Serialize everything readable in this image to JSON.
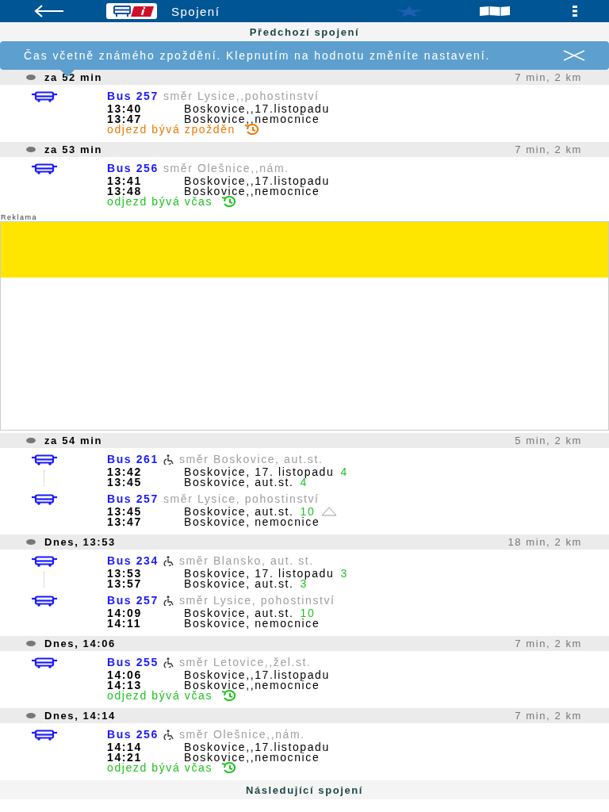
{
  "app_bar": {
    "title": "Spojení",
    "favorite": false
  },
  "previous_button": "Předchozí spojení",
  "tooltip": {
    "text": "Čas včetně známého zpoždění. Klepnutím na hodnotu změníte nastavení."
  },
  "connections": [
    {
      "header": "za 52 min",
      "summary": "7 min, 2 km",
      "legs": [
        {
          "line": "Bus 257",
          "accessible": false,
          "direction": "směr Lysice,,pohostinství",
          "stops": [
            {
              "time": "13:40",
              "name": "Boskovice,,17.listopadu",
              "alert": false
            },
            {
              "time": "13:47",
              "name": "Boskovice,,nemocnice",
              "alert": false
            }
          ]
        }
      ],
      "status": {
        "kind": "late",
        "text": "odjezd bývá zpožděn"
      }
    },
    {
      "header": "za 53 min",
      "summary": "7 min, 2 km",
      "legs": [
        {
          "line": "Bus 256",
          "accessible": false,
          "direction": "směr Olešnice,,nám.",
          "stops": [
            {
              "time": "13:41",
              "name": "Boskovice,,17.listopadu",
              "alert": false
            },
            {
              "time": "13:48",
              "name": "Boskovice,,nemocnice",
              "alert": false
            }
          ]
        }
      ],
      "status": {
        "kind": "ontime",
        "text": "odjezd bývá včas"
      }
    },
    {
      "kind": "ad",
      "label": "Reklama"
    },
    {
      "header": "za 54 min",
      "summary": "5 min, 2 km",
      "legs": [
        {
          "line": "Bus 261",
          "accessible": true,
          "direction": "směr Boskovice, aut.st.",
          "stops": [
            {
              "time": "13:42",
              "name": "Boskovice, 17. listopadu",
              "platform": "4",
              "alert": false
            },
            {
              "time": "13:45",
              "name": "Boskovice, aut.st.",
              "platform": "4",
              "alert": false
            }
          ]
        },
        {
          "line": "Bus 257",
          "accessible": false,
          "direction": "směr Lysice, pohostinství",
          "stops": [
            {
              "time": "13:45",
              "name": "Boskovice, aut.st.",
              "platform": "10",
              "alert": true
            },
            {
              "time": "13:47",
              "name": "Boskovice, nemocnice",
              "alert": false
            }
          ]
        }
      ]
    },
    {
      "header": "Dnes, 13:53",
      "summary": "18 min, 2 km",
      "legs": [
        {
          "line": "Bus 234",
          "accessible": true,
          "direction": "směr Blansko, aut. st.",
          "stops": [
            {
              "time": "13:53",
              "name": "Boskovice, 17. listopadu",
              "platform": "3",
              "alert": false
            },
            {
              "time": "13:57",
              "name": "Boskovice, aut.st.",
              "platform": "3",
              "alert": false
            }
          ]
        },
        {
          "line": "Bus 257",
          "accessible": true,
          "direction": "směr Lysice, pohostinství",
          "stops": [
            {
              "time": "14:09",
              "name": "Boskovice, aut.st.",
              "platform": "10",
              "alert": false
            },
            {
              "time": "14:11",
              "name": "Boskovice, nemocnice",
              "alert": false
            }
          ]
        }
      ]
    },
    {
      "header": "Dnes, 14:06",
      "summary": "7 min, 2 km",
      "legs": [
        {
          "line": "Bus 255",
          "accessible": true,
          "direction": "směr Letovice,,žel.st.",
          "stops": [
            {
              "time": "14:06",
              "name": "Boskovice,,17.listopadu",
              "alert": false
            },
            {
              "time": "14:13",
              "name": "Boskovice,,nemocnice",
              "alert": false
            }
          ]
        }
      ],
      "status": {
        "kind": "ontime",
        "text": "odjezd bývá včas"
      }
    },
    {
      "header": "Dnes, 14:14",
      "summary": "7 min, 2 km",
      "legs": [
        {
          "line": "Bus 256",
          "accessible": true,
          "direction": "směr Olešnice,,nám.",
          "stops": [
            {
              "time": "14:14",
              "name": "Boskovice,,17.listopadu",
              "alert": false
            },
            {
              "time": "14:21",
              "name": "Boskovice,,nemocnice",
              "alert": false
            }
          ]
        }
      ],
      "status": {
        "kind": "ontime",
        "text": "odjezd bývá včas"
      }
    }
  ],
  "next_button": "Následující spojení"
}
